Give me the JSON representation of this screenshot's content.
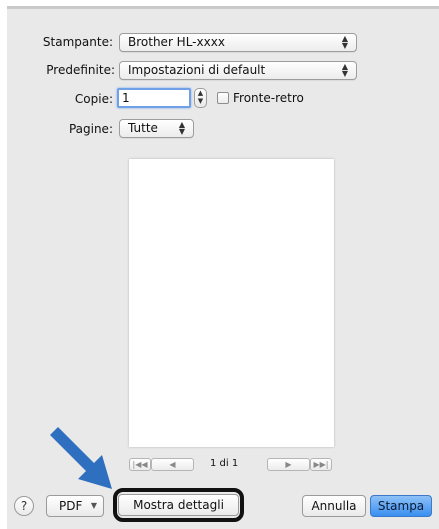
{
  "printer": {
    "label": "Stampante:",
    "value": "Brother HL-xxxx"
  },
  "presets": {
    "label": "Predefinite:",
    "value": "Impostazioni di default"
  },
  "copies": {
    "label": "Copie:",
    "value": "1",
    "duplex_label": "Fronte-retro"
  },
  "pages": {
    "label": "Pagine:",
    "value": "Tutte"
  },
  "preview": {
    "page_indicator": "1 di 1"
  },
  "footer": {
    "help_label": "?",
    "pdf_label": "PDF",
    "details_label": "Mostra dettagli",
    "cancel_label": "Annulla",
    "print_label": "Stampa"
  },
  "colors": {
    "accent": "#3a8ff0",
    "arrow": "#2f6fbf",
    "highlight": "#111111"
  }
}
